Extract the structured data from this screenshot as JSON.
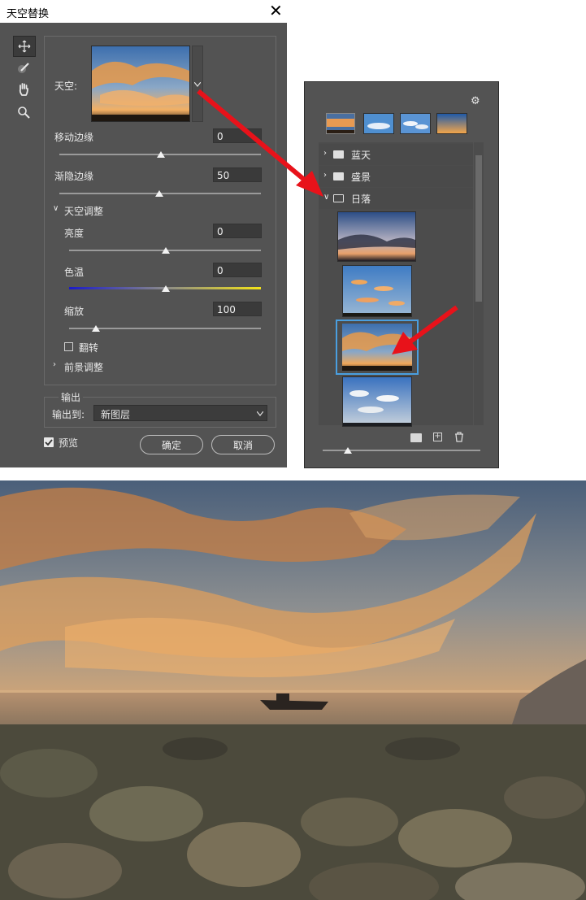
{
  "dialog": {
    "title": "天空替换",
    "close_glyph": "✕",
    "sky_label": "天空:",
    "shift_edge_label": "移动边缘",
    "shift_edge_value": "0",
    "fade_edge_label": "渐隐边缘",
    "fade_edge_value": "50",
    "sky_adjust_section": "天空调整",
    "brightness_label": "亮度",
    "brightness_value": "0",
    "temperature_label": "色温",
    "temperature_value": "0",
    "scale_label": "缩放",
    "scale_value": "100",
    "flip_label": "翻转",
    "foreground_section": "前景调整",
    "output_section": "输出",
    "output_to_label": "输出到:",
    "output_to_value": "新图层",
    "preview_label": "预览",
    "ok_button": "确定",
    "cancel_button": "取消",
    "icons": [
      "move-icon",
      "brush-icon",
      "hand-icon",
      "zoom-icon",
      "chevron-down-icon"
    ]
  },
  "sky_picker": {
    "gear_glyph": "⚙",
    "folders": [
      {
        "name": "蓝天",
        "expanded": false
      },
      {
        "name": "盛景",
        "expanded": false
      },
      {
        "name": "日落",
        "expanded": true
      }
    ],
    "icons": [
      "new-folder-icon",
      "add-sky-icon",
      "trash-icon",
      "gear-icon"
    ]
  },
  "colors": {
    "panel_bg": "#535353",
    "accent_selection": "#4a9fe0",
    "arrow_red": "#e8121a"
  }
}
